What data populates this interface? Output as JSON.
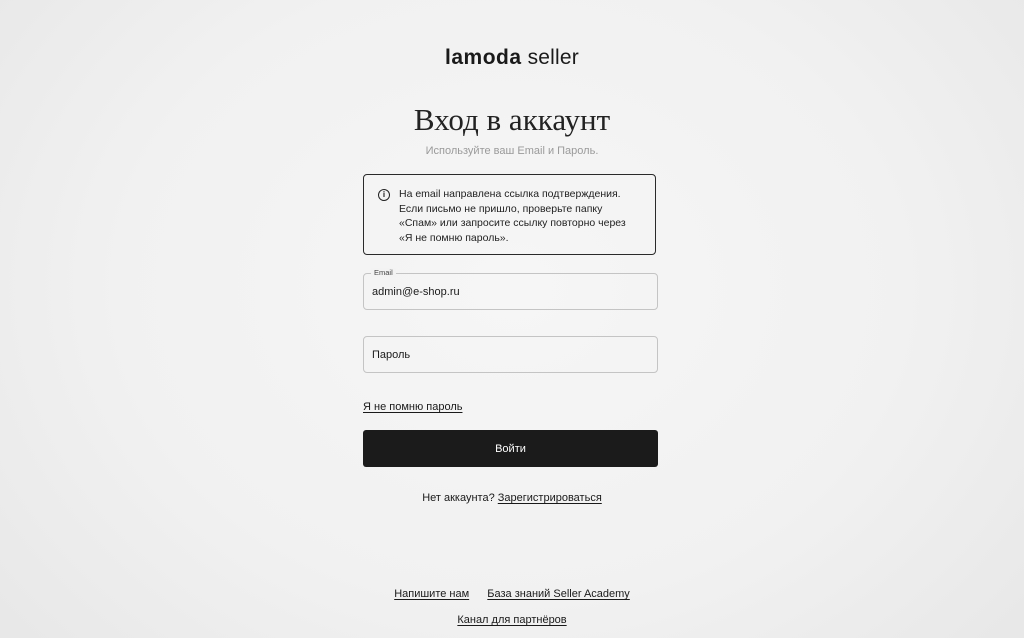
{
  "logo": {
    "brand": "lamoda",
    "suffix": "seller"
  },
  "title": "Вход в аккаунт",
  "subtitle": "Используйте ваш Email и Пароль.",
  "notice": {
    "icon": "info-icon",
    "text": "На email направлена ссылка подтверждения. Если письмо не пришло, проверьте папку «Спам» или запросите ссылку повторно через «Я не помню пароль»."
  },
  "form": {
    "email_label": "Email",
    "email_value": "admin@e-shop.ru",
    "password_placeholder": "Пароль",
    "forgot_link": "Я не помню пароль",
    "submit_label": "Войти"
  },
  "signup": {
    "prompt": "Нет аккаунта?",
    "link": "Зарегистрироваться"
  },
  "footer": {
    "write_us": "Напишите нам",
    "knowledge_base": "База знаний Seller Academy",
    "partner_channel": "Канал для партнёров"
  },
  "colors": {
    "background": "#f1f1f1",
    "button": "#1b1b1b",
    "button_text": "#ffffff",
    "border": "#c4c4c4",
    "subtitle": "#9a9a9a"
  }
}
